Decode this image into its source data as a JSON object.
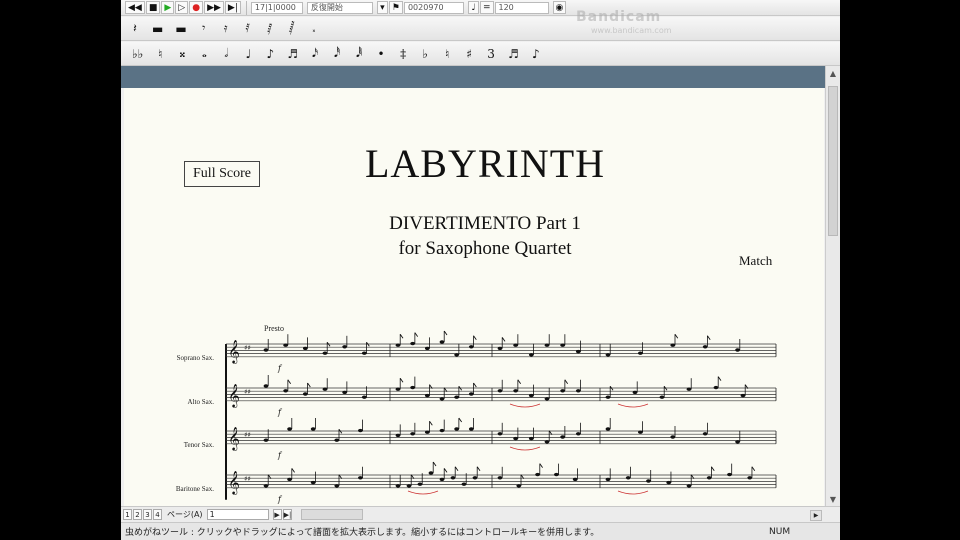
{
  "toolbar1": {
    "bar_field": "17|1|0000",
    "mode": "反復開始",
    "field2": "0020970",
    "tempo": "120"
  },
  "watermark": {
    "brand": "Bandicam",
    "url": "www.bandicam.com"
  },
  "toolbar2": {
    "tools": [
      "𝄽",
      "▬",
      "▬",
      "𝄾",
      "𝄿",
      "𝅀",
      "𝅁",
      "𝅂",
      "𝅃"
    ]
  },
  "toolbar3": {
    "tools": [
      "♭♭",
      "♮",
      "𝄪",
      "𝅝",
      "𝅗𝅥",
      "♩",
      "♪",
      "♬",
      "𝅘𝅥𝅯",
      "𝅘𝅥𝅰",
      "𝅘𝅥𝅱",
      "•",
      "‡",
      "♭",
      "♮",
      "♯",
      "3",
      "♬",
      "♪"
    ]
  },
  "score": {
    "full_score_label": "Full Score",
    "title": "LABYRINTH",
    "subtitle": "DIVERTIMENTO Part 1",
    "instrumentation": "for Saxophone Quartet",
    "composer": "Match",
    "tempo_marking": "Presto",
    "staves": [
      {
        "name": "Soprano Sax."
      },
      {
        "name": "Alto Sax."
      },
      {
        "name": "Tenor Sax."
      },
      {
        "name": "Baritone Sax."
      }
    ]
  },
  "navbar": {
    "buttons": [
      "1",
      "2",
      "3",
      "4"
    ],
    "page_label": "ページ(A)",
    "page_value": "1"
  },
  "statusbar": {
    "message": "虫めがねツール : クリックやドラッグによって譜面を拡大表示します。縮小するにはコントロールキーを併用します。",
    "num": "NUM"
  }
}
